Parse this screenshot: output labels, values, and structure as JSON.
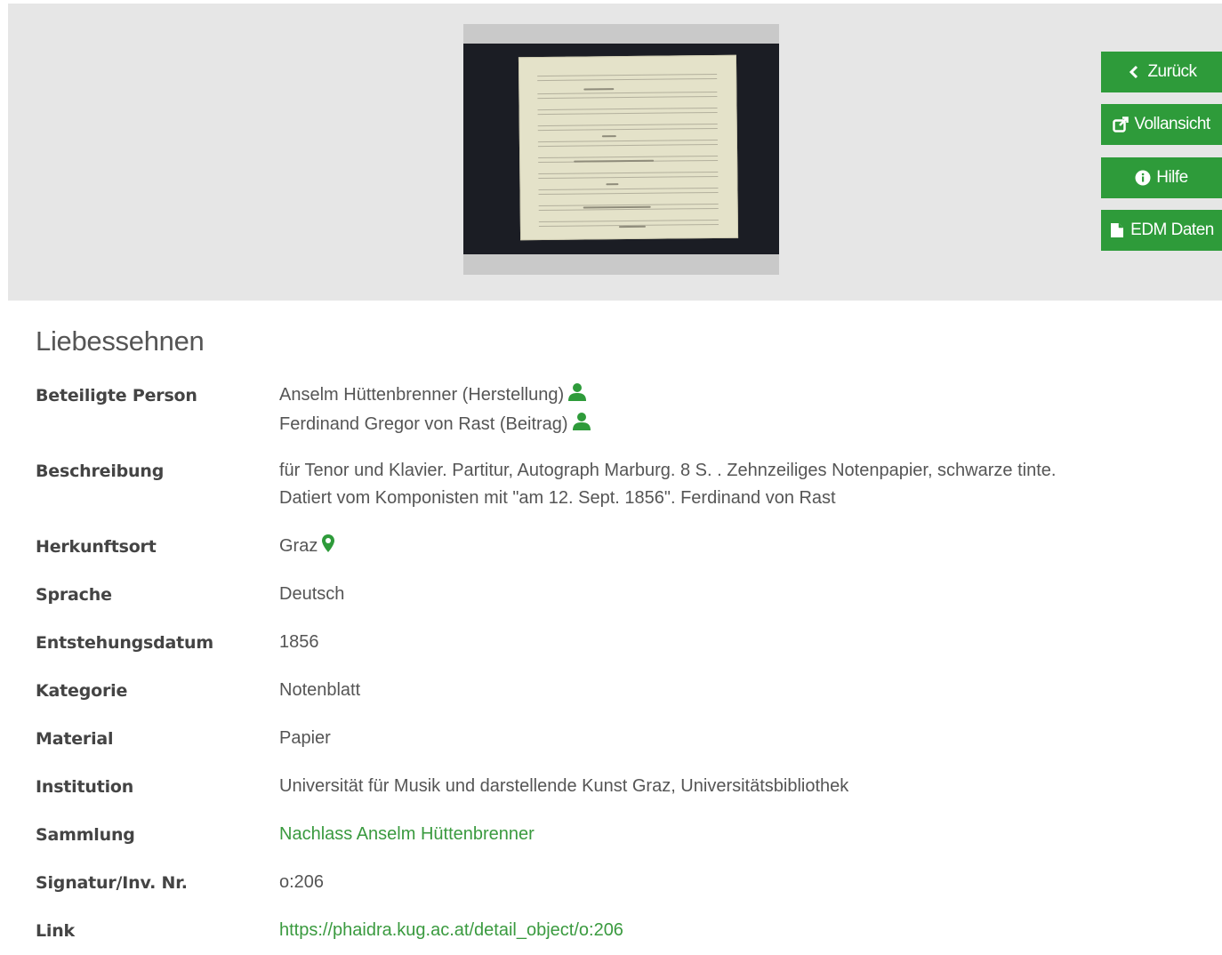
{
  "buttons": {
    "back": "Zurück",
    "fullview": "Vollansicht",
    "help": "Hilfe",
    "edm": "EDM Daten"
  },
  "title": "Liebessehnen",
  "fields": {
    "persons": {
      "label": "Beteiligte Person",
      "values": [
        "Anselm Hüttenbrenner (Herstellung)",
        "Ferdinand Gregor von Rast (Beitrag)"
      ]
    },
    "description": {
      "label": "Beschreibung",
      "lines": [
        "für Tenor und Klavier.   Partitur, Autograph   Marburg.   8 S. . Zehnzeiliges Notenpapier, schwarze tinte.",
        "Datiert vom Komponisten mit \"am 12. Sept. 1856\". Ferdinand von Rast"
      ]
    },
    "origin": {
      "label": "Herkunftsort",
      "value": "Graz"
    },
    "language": {
      "label": "Sprache",
      "value": "Deutsch"
    },
    "date": {
      "label": "Entstehungsdatum",
      "value": "1856"
    },
    "category": {
      "label": "Kategorie",
      "value": "Notenblatt"
    },
    "material": {
      "label": "Material",
      "value": "Papier"
    },
    "institution": {
      "label": "Institution",
      "value": "Universität für Musik und darstellende Kunst Graz, Universitätsbibliothek"
    },
    "collection": {
      "label": "Sammlung",
      "value": "Nachlass Anselm Hüttenbrenner"
    },
    "signature": {
      "label": "Signatur/Inv. Nr.",
      "value": "o:206"
    },
    "link": {
      "label": "Link",
      "value": "https://phaidra.kug.ac.at/detail_object/o:206"
    }
  },
  "icons": {
    "person": "user-icon",
    "location": "map-marker-icon",
    "back": "chevron-left-icon",
    "fullview": "external-link-icon",
    "help": "info-circle-icon",
    "edm": "file-icon"
  },
  "colors": {
    "accent": "#2e9b3a",
    "link": "#3a9a3f",
    "viewer_bg": "#e6e6e6"
  }
}
